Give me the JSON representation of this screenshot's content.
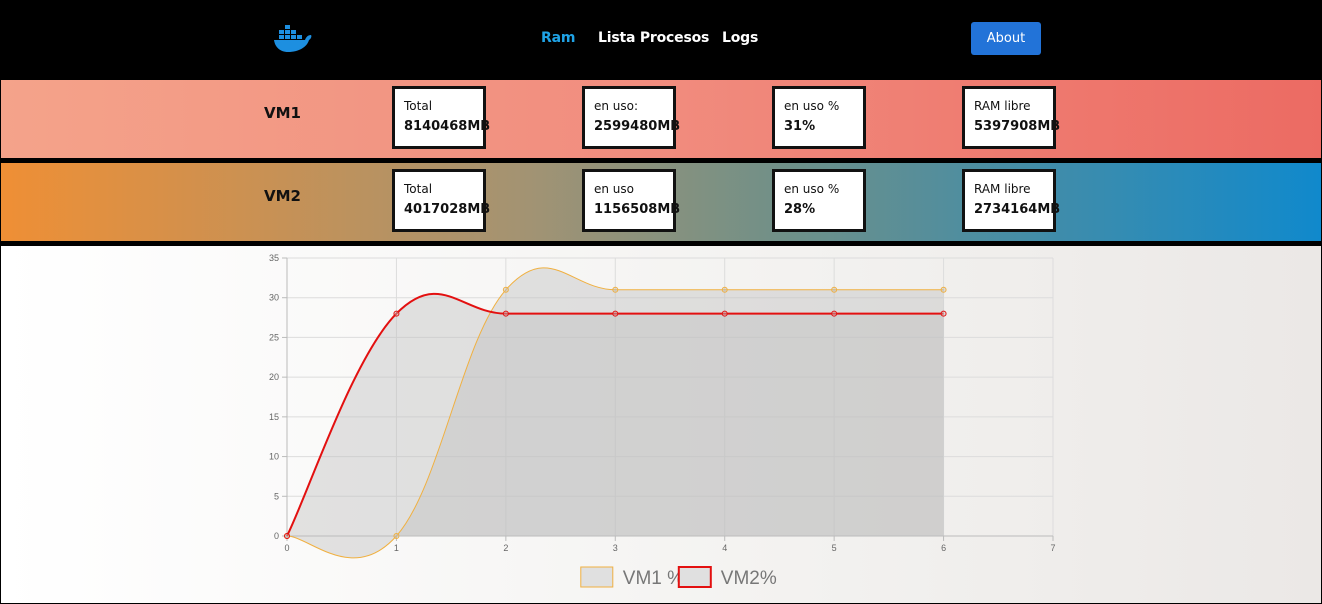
{
  "nav": {
    "logo_icon": "docker-whale-icon",
    "links": [
      {
        "label": "Ram",
        "active": true
      },
      {
        "label": "Lista Procesos",
        "active": false
      },
      {
        "label": "Logs",
        "active": false
      }
    ],
    "about_label": "About",
    "active_color": "#1fa3e6",
    "button_color": "#2273d8"
  },
  "vms": [
    {
      "name": "VM1",
      "stats": [
        {
          "label": "Total",
          "value": "8140468MB"
        },
        {
          "label": "en uso:",
          "value": "2599480MB"
        },
        {
          "label": "en uso %",
          "value": "31%"
        },
        {
          "label": "RAM libre",
          "value": "5397908MB"
        }
      ]
    },
    {
      "name": "VM2",
      "stats": [
        {
          "label": "Total",
          "value": "4017028MB"
        },
        {
          "label": "en uso",
          "value": "1156508MB"
        },
        {
          "label": "en uso %",
          "value": "28%"
        },
        {
          "label": "RAM libre",
          "value": "2734164MB"
        }
      ]
    }
  ],
  "chart_data": {
    "type": "line",
    "x": [
      0,
      1,
      2,
      3,
      4,
      5,
      6
    ],
    "xlim": [
      0,
      7
    ],
    "xticks": [
      0,
      1,
      2,
      3,
      4,
      5,
      6,
      7
    ],
    "ylim": [
      0,
      35
    ],
    "yticks": [
      0,
      5,
      10,
      15,
      20,
      25,
      30,
      35
    ],
    "grid": true,
    "legend_position": "bottom",
    "series": [
      {
        "name": "VM1 %",
        "values": [
          0,
          0,
          31,
          31,
          31,
          31,
          31
        ],
        "color": "#f0b040",
        "fill": "rgba(190,190,190,0.42)",
        "stroke_width": 1
      },
      {
        "name": "VM2%",
        "values": [
          0,
          28,
          28,
          28,
          28,
          28,
          28
        ],
        "color": "#e31010",
        "fill": "rgba(190,190,190,0.42)",
        "stroke_width": 2
      }
    ]
  }
}
